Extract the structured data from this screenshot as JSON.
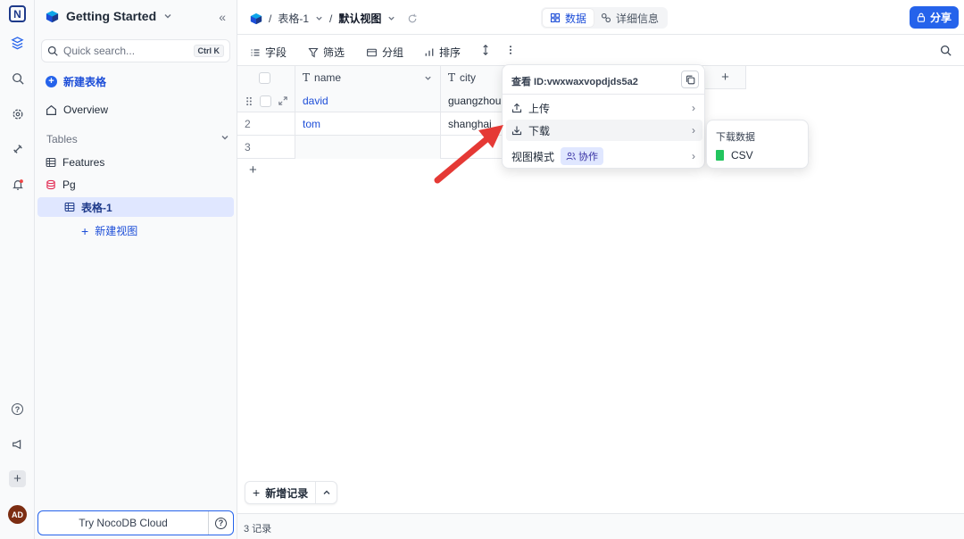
{
  "rail": {
    "logo": "N",
    "avatar": "AD"
  },
  "sidebar": {
    "workspace": "Getting Started",
    "search_placeholder": "Quick search...",
    "search_shortcut": "Ctrl K",
    "new_table": "新建表格",
    "overview": "Overview",
    "tables_heading": "Tables",
    "tables": [
      {
        "label": "Features"
      },
      {
        "label": "Pg"
      },
      {
        "label": "表格-1"
      }
    ],
    "new_view": "新建视图",
    "try_cloud": "Try NocoDB Cloud"
  },
  "header": {
    "breadcrumb_table": "表格-1",
    "breadcrumb_view": "默认视图",
    "tab_data": "数据",
    "tab_details": "详细信息",
    "share": "分享"
  },
  "toolbar": {
    "fields": "字段",
    "filter": "筛选",
    "group": "分组",
    "sort": "排序"
  },
  "grid": {
    "columns": [
      "name",
      "city"
    ],
    "rows": [
      {
        "index": "",
        "name": "david",
        "city": "guangzhou"
      },
      {
        "index": "2",
        "name": "tom",
        "city": "shanghai"
      },
      {
        "index": "3",
        "name": "",
        "city": ""
      }
    ]
  },
  "view_menu": {
    "view_id": "查看 ID:vwxwaxvopdjds5a2",
    "upload": "上传",
    "download": "下载",
    "view_mode": "视图模式",
    "view_mode_tag": "协作"
  },
  "download_submenu": {
    "heading": "下载数据",
    "csv": "CSV"
  },
  "footer": {
    "add_record": "新增记录",
    "record_count": "3 记录"
  },
  "colors": {
    "accent": "#2563eb",
    "arrow": "#e53935"
  }
}
